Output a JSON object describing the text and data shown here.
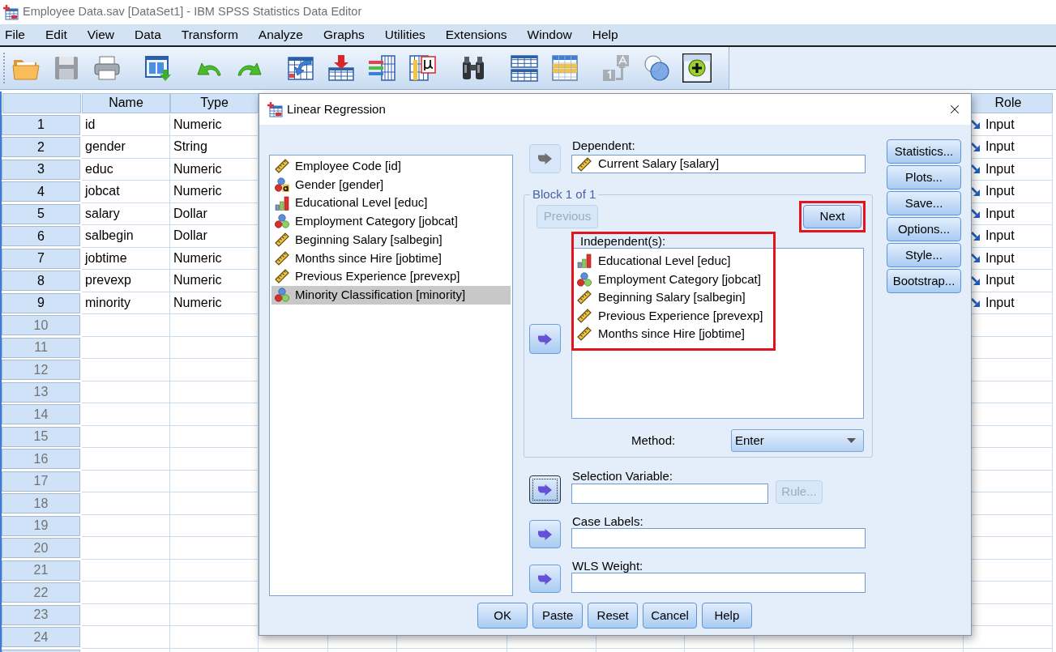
{
  "window": {
    "title": "Employee Data.sav [DataSet1] - IBM SPSS Statistics Data Editor"
  },
  "menu": [
    {
      "label": "File"
    },
    {
      "label": "Edit"
    },
    {
      "label": "View"
    },
    {
      "label": "Data"
    },
    {
      "label": "Transform"
    },
    {
      "label": "Analyze"
    },
    {
      "label": "Graphs"
    },
    {
      "label": "Utilities"
    },
    {
      "label": "Extensions"
    },
    {
      "label": "Window"
    },
    {
      "label": "Help"
    }
  ],
  "toolbar_groups": [
    [
      {
        "kind": "open",
        "disabled": false,
        "pressed": false
      },
      {
        "kind": "save",
        "disabled": true,
        "pressed": false
      },
      {
        "kind": "print",
        "disabled": false,
        "pressed": false
      }
    ],
    [
      {
        "kind": "recall",
        "disabled": false,
        "pressed": false
      }
    ],
    [
      {
        "kind": "undo",
        "disabled": false,
        "pressed": false
      },
      {
        "kind": "redo",
        "disabled": false,
        "pressed": false
      }
    ],
    [
      {
        "kind": "gotocase",
        "disabled": false,
        "pressed": false
      },
      {
        "kind": "gotovariable",
        "disabled": false,
        "pressed": false
      },
      {
        "kind": "variables",
        "disabled": false,
        "pressed": false
      },
      {
        "kind": "descriptives",
        "disabled": false,
        "pressed": false
      }
    ],
    [
      {
        "kind": "find",
        "disabled": false,
        "pressed": false
      }
    ],
    [
      {
        "kind": "split",
        "disabled": false,
        "pressed": false
      },
      {
        "kind": "select",
        "disabled": false,
        "pressed": false
      }
    ],
    [
      {
        "kind": "valuelabels",
        "disabled": true,
        "pressed": false
      },
      {
        "kind": "sets",
        "disabled": false,
        "pressed": false
      },
      {
        "kind": "showall",
        "disabled": false,
        "pressed": true
      }
    ]
  ],
  "data_grid": {
    "columns": [
      {
        "label": "Name"
      },
      {
        "label": "Type"
      },
      {
        "label": "Role"
      }
    ],
    "rows": [
      {
        "number": "1",
        "cells": [
          "id",
          "Numeric",
          "Input"
        ]
      },
      {
        "number": "2",
        "cells": [
          "gender",
          "String",
          "Input"
        ]
      },
      {
        "number": "3",
        "cells": [
          "educ",
          "Numeric",
          "Input"
        ]
      },
      {
        "number": "4",
        "cells": [
          "jobcat",
          "Numeric",
          "Input"
        ]
      },
      {
        "number": "5",
        "cells": [
          "salary",
          "Dollar",
          "Input"
        ]
      },
      {
        "number": "6",
        "cells": [
          "salbegin",
          "Dollar",
          "Input"
        ]
      },
      {
        "number": "7",
        "cells": [
          "jobtime",
          "Numeric",
          "Input"
        ]
      },
      {
        "number": "8",
        "cells": [
          "prevexp",
          "Numeric",
          "Input"
        ]
      },
      {
        "number": "9",
        "cells": [
          "minority",
          "Numeric",
          "Input"
        ]
      },
      {
        "number": "10"
      },
      {
        "number": "11"
      },
      {
        "number": "12"
      },
      {
        "number": "13"
      },
      {
        "number": "14"
      },
      {
        "number": "15"
      },
      {
        "number": "16"
      },
      {
        "number": "17"
      },
      {
        "number": "18"
      },
      {
        "number": "19"
      },
      {
        "number": "20"
      },
      {
        "number": "21"
      },
      {
        "number": "22"
      },
      {
        "number": "23"
      },
      {
        "number": "24"
      }
    ]
  },
  "dialog": {
    "title": "Linear Regression",
    "variables": [
      {
        "label": "Employee Code [id]",
        "kind": "scale",
        "selected": false
      },
      {
        "label": "Gender [gender]",
        "kind": "string",
        "selected": false
      },
      {
        "label": "Educational Level [educ]",
        "kind": "ordinal",
        "selected": false
      },
      {
        "label": "Employment Category [jobcat]",
        "kind": "nominal",
        "selected": false
      },
      {
        "label": "Beginning Salary [salbegin]",
        "kind": "scale",
        "selected": false
      },
      {
        "label": "Months since Hire [jobtime]",
        "kind": "scale",
        "selected": false
      },
      {
        "label": "Previous Experience [prevexp]",
        "kind": "scale",
        "selected": false
      },
      {
        "label": "Minority Classification [minority]",
        "kind": "nominal",
        "selected": true
      }
    ],
    "dependent": {
      "label": "Dependent:",
      "arrow": {
        "disabled": true,
        "focused": false
      },
      "value": {
        "label": "Current Salary [salary]",
        "kind": "scale"
      }
    },
    "block": {
      "title": "Block 1 of 1",
      "previous": {
        "label": "Previous",
        "disabled": true,
        "highlighted": false
      },
      "next": {
        "label": "Next",
        "disabled": false,
        "highlighted": true
      },
      "independents": {
        "label": "Independent(s):",
        "highlighted": true,
        "arrow": {
          "disabled": false,
          "focused": false
        },
        "items": [
          {
            "label": "Educational Level [educ]",
            "kind": "ordinal",
            "selected": false
          },
          {
            "label": "Employment Category [jobcat]",
            "kind": "nominal",
            "selected": false
          },
          {
            "label": "Beginning Salary [salbegin]",
            "kind": "scale",
            "selected": false
          },
          {
            "label": "Previous Experience [prevexp]",
            "kind": "scale",
            "selected": false
          },
          {
            "label": "Months since Hire [jobtime]",
            "kind": "scale",
            "selected": false
          }
        ]
      },
      "method": {
        "label": "Method:",
        "value": "Enter"
      }
    },
    "selection_variable": {
      "label": "Selection Variable:",
      "arrow": {
        "disabled": false,
        "focused": true
      },
      "rule": {
        "label": "Rule...",
        "disabled": true
      }
    },
    "case_labels": {
      "label": "Case Labels:",
      "arrow": {
        "disabled": false,
        "focused": false
      }
    },
    "wls_weight": {
      "label": "WLS Weight:",
      "arrow": {
        "disabled": false,
        "focused": false
      }
    },
    "side_buttons": [
      {
        "label": "Statistics..."
      },
      {
        "label": "Plots..."
      },
      {
        "label": "Save..."
      },
      {
        "label": "Options..."
      },
      {
        "label": "Style..."
      },
      {
        "label": "Bootstrap..."
      }
    ],
    "buttons": [
      {
        "label": "OK"
      },
      {
        "label": "Paste"
      },
      {
        "label": "Reset"
      },
      {
        "label": "Cancel"
      },
      {
        "label": "Help"
      }
    ]
  }
}
